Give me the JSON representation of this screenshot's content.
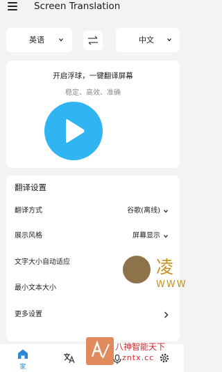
{
  "app_bar": {
    "title": "Screen Translation"
  },
  "language_row": {
    "source_language": "英语",
    "target_language": "中文"
  },
  "hero": {
    "title": "开启浮球，一键翻译屏幕",
    "subtitle": "稳定、高效、准确"
  },
  "settings": {
    "title": "翻译设置",
    "rows": [
      {
        "label": "翻译方式",
        "value": "谷歌(离线)"
      },
      {
        "label": "展示风格",
        "value": "屏幕显示"
      },
      {
        "label": "文字大小自动适应",
        "value": ""
      },
      {
        "label": "最小文本大小",
        "value": ""
      },
      {
        "label": "更多设置",
        "value": ""
      }
    ]
  },
  "bottom_nav": {
    "home_label": "家"
  },
  "watermarks": {
    "overlay_char": "凌",
    "overlay_www": "WWW",
    "brand_text": "八神智能天下",
    "brand_url": "zntx.cc"
  },
  "colors": {
    "accent": "#31b4f2",
    "nav_active": "#2a8ad8",
    "background": "#f2f3f5",
    "card": "#ffffff"
  }
}
